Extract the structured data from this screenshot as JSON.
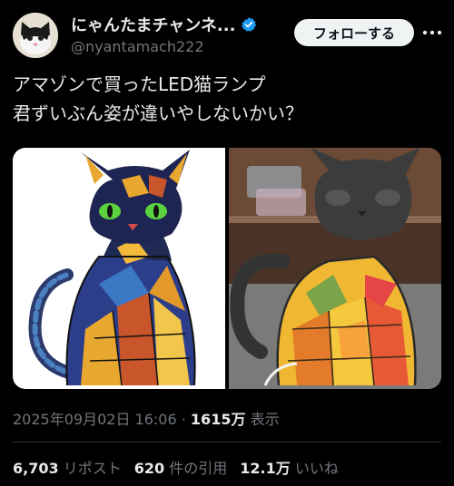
{
  "author": {
    "display_name": "にゃんたまチャンネ...",
    "handle": "@nyantamach222",
    "verified_icon": "verified-badge-icon",
    "accent_color": "#1d9bf0"
  },
  "follow_button": {
    "label": "フォローする"
  },
  "more_button": {
    "icon": "more-options-icon"
  },
  "post": {
    "lines": [
      "アマゾンで買ったLED猫ランプ",
      "君ずいぶん姿が違いやしないかい？"
    ]
  },
  "media": [
    {
      "alt": "stained glass cat illustration"
    },
    {
      "alt": "LED cat lamp photo"
    }
  ],
  "meta": {
    "timestamp": "2025年09月02日 16:06",
    "separator": "·",
    "views_count": "1615万",
    "views_label": "表示"
  },
  "stats": {
    "reposts_count": "6,703",
    "reposts_label": "リポスト",
    "quotes_count": "620",
    "quotes_label": "件の引用",
    "likes_count": "12.1万",
    "likes_label": "いいね"
  }
}
